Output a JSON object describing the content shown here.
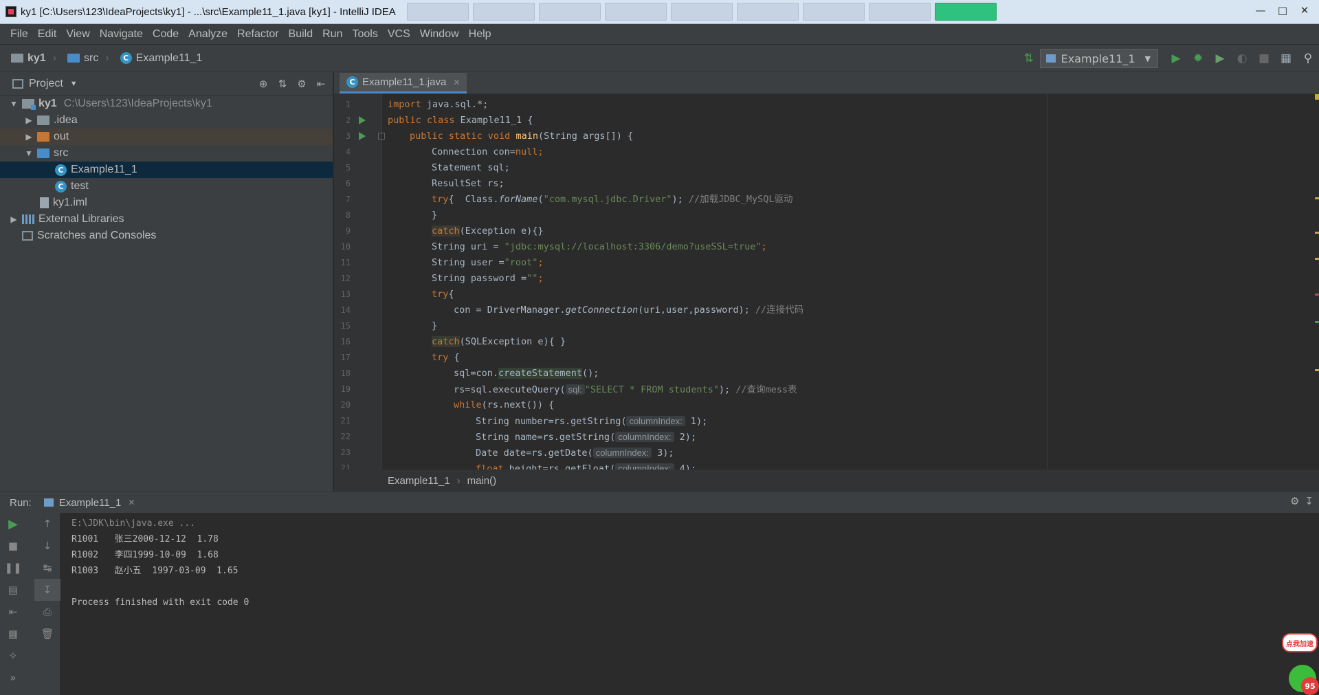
{
  "window": {
    "title": "ky1 [C:\\Users\\123\\IdeaProjects\\ky1] - ...\\src\\Example11_1.java [ky1] - IntelliJ IDEA",
    "controls": [
      "minimize",
      "maximize",
      "close"
    ]
  },
  "menu": [
    "File",
    "Edit",
    "View",
    "Navigate",
    "Code",
    "Analyze",
    "Refactor",
    "Build",
    "Run",
    "Tools",
    "VCS",
    "Window",
    "Help"
  ],
  "breadcrumb": [
    "ky1",
    "src",
    "Example11_1"
  ],
  "toolbar": {
    "run_config": "Example11_1"
  },
  "project": {
    "header": "Project",
    "tree": [
      {
        "label": "ky1",
        "path": "C:\\Users\\123\\IdeaProjects\\ky1"
      },
      {
        "label": ".idea"
      },
      {
        "label": "out"
      },
      {
        "label": "src"
      },
      {
        "label": "Example11_1"
      },
      {
        "label": "test"
      },
      {
        "label": "ky1.iml"
      },
      {
        "label": "External Libraries"
      },
      {
        "label": "Scratches and Consoles"
      }
    ]
  },
  "editor": {
    "tab": "Example11_1.java",
    "line_numbers": [
      "1",
      "2",
      "3",
      "4",
      "5",
      "6",
      "7",
      "8",
      "9",
      "10",
      "11",
      "12",
      "13",
      "14",
      "15",
      "16",
      "17",
      "18",
      "19",
      "20",
      "21",
      "22",
      "23",
      "21"
    ],
    "lines": [
      [
        "import",
        " java.sql.*;"
      ],
      [
        "public class",
        " Example11_1 {"
      ],
      [
        "public static void",
        "main",
        "(String args[]) {"
      ],
      [
        "Connection con=",
        "null",
        ";"
      ],
      [
        "Statement sql;"
      ],
      [
        "ResultSet rs;"
      ],
      [
        "try",
        "{  Class.",
        "forName",
        "(",
        "\"com.mysql.jdbc.Driver\"",
        "); ",
        "//加载JDBC_MySQL驱动"
      ],
      [
        "}"
      ],
      [
        "catch",
        "(Exception e){}"
      ],
      [
        "String uri = ",
        "\"jdbc:mysql://localhost:3306/demo?useSSL=true\"",
        ";"
      ],
      [
        "String user =",
        "\"root\"",
        ";"
      ],
      [
        "String password =",
        "\"\"",
        ";"
      ],
      [
        "try",
        "{"
      ],
      [
        "con = DriverManager.",
        "getConnection",
        "(uri,user,password); ",
        "//连接代码"
      ],
      [
        "}"
      ],
      [
        "catch",
        "(SQLException e){ }"
      ],
      [
        "try",
        " {"
      ],
      [
        "sql=con.",
        "createStatement",
        "();"
      ],
      [
        "rs=sql.executeQuery(",
        "sql:",
        "\"SELECT * FROM students\"",
        "); ",
        "//查询mess表"
      ],
      [
        "while",
        "(rs.next()) {"
      ],
      [
        "String number=rs.getString(",
        "columnIndex:",
        " 1);"
      ],
      [
        "String name=rs.getString(",
        "columnIndex:",
        " 2);"
      ],
      [
        "Date date=rs.getDate(",
        "columnIndex:",
        " 3);"
      ],
      [
        "float",
        " height=rs.getFloat(",
        "columnIndex:",
        " 4);"
      ]
    ],
    "breadcrumb": [
      "Example11_1",
      "main()"
    ]
  },
  "run": {
    "label": "Run:",
    "tab": "Example11_1",
    "console": [
      "E:\\JDK\\bin\\java.exe ...",
      "R1001   张三2000-12-12  1.78",
      "R1002   李四1999-10-09  1.68",
      "R1003   赵小五  1997-03-09  1.65",
      "",
      "Process finished with exit code 0"
    ]
  },
  "widget": {
    "bubble": "点我加速",
    "badge": "95"
  }
}
